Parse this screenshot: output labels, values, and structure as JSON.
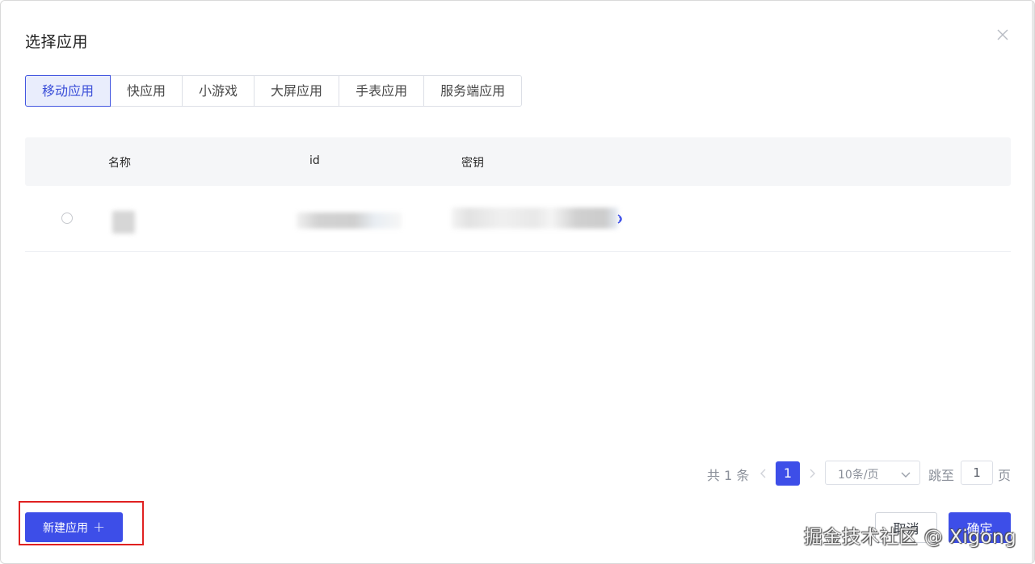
{
  "dialog": {
    "title": "选择应用"
  },
  "tabs": [
    {
      "label": "移动应用",
      "active": true
    },
    {
      "label": "快应用",
      "active": false
    },
    {
      "label": "小游戏",
      "active": false
    },
    {
      "label": "大屏应用",
      "active": false
    },
    {
      "label": "手表应用",
      "active": false
    },
    {
      "label": "服务端应用",
      "active": false
    }
  ],
  "table": {
    "columns": [
      "名称",
      "id",
      "密钥"
    ]
  },
  "pagination": {
    "total": "共 1 条",
    "current_page": "1",
    "page_size": "10条/页",
    "jump_label": "跳至",
    "jump_value": "1",
    "page_unit": "页"
  },
  "footer": {
    "new_app_label": "新建应用",
    "cancel_label": "取消",
    "confirm_label": "确定"
  },
  "watermark": "掘金技术社区 @ Xigong",
  "colors": {
    "primary": "#3d4ee8",
    "highlight": "#e02020"
  },
  "icons": {
    "close": "close-icon",
    "prev": "chevron-left-icon",
    "next": "chevron-right-icon",
    "dropdown": "chevron-down-icon",
    "reveal": "eye-icon",
    "add": "plus-icon"
  }
}
